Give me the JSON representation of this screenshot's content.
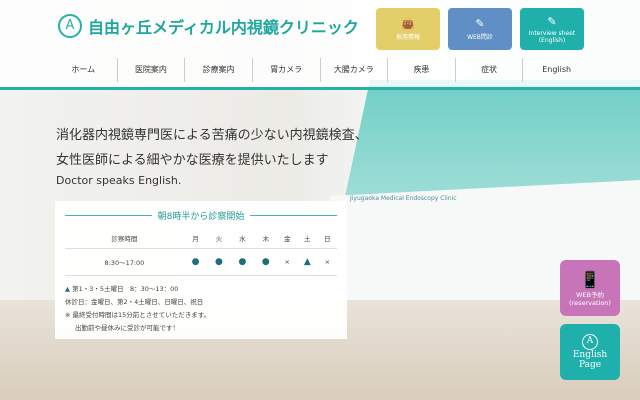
{
  "header": {
    "logo_text": "自由ヶ丘メディカル内視鏡クリニック",
    "buttons": [
      {
        "label": "採用情報",
        "color": "#e3cf6a"
      },
      {
        "label": "WEB問診",
        "color": "#5f8fc4"
      },
      {
        "label": "Interview sheet (English)",
        "color": "#1fb0ab"
      }
    ]
  },
  "nav": [
    "ホーム",
    "医院案内",
    "診療案内",
    "胃カメラ",
    "大腸カメラ",
    "疾患",
    "症状",
    "English"
  ],
  "hero": {
    "line1": "消化器内視鏡専門医による苦痛の少ない内視鏡検査、",
    "line2": "女性医師による細やかな医療を提供いたします",
    "line3": "Doctor speaks English.",
    "sign": "Jiyugaoka Medical Endoscopy Clinic"
  },
  "schedule": {
    "title": "朝8時半から診察開始",
    "header": [
      "診察時間",
      "月",
      "火",
      "水",
      "木",
      "金",
      "土",
      "日"
    ],
    "row": [
      "8:30〜17:00",
      "●",
      "●",
      "●",
      "●",
      "×",
      "▲",
      "×"
    ],
    "note1": "第1・3・5土曜日　8：30〜13：00",
    "note2": "休診日：金曜日、第2・4土曜日、日曜日、祝日",
    "note3": "※ 最終受付時間は15分前とさせていただきます。",
    "note4": "出勤前や昼休みに受診が可能です！"
  },
  "side": {
    "web_label": "WEB予約",
    "web_sub": "(reservation)",
    "web_color": "#c874b8",
    "eng_label": "English",
    "eng_sub": "Page",
    "eng_color": "#1fb0ab"
  }
}
